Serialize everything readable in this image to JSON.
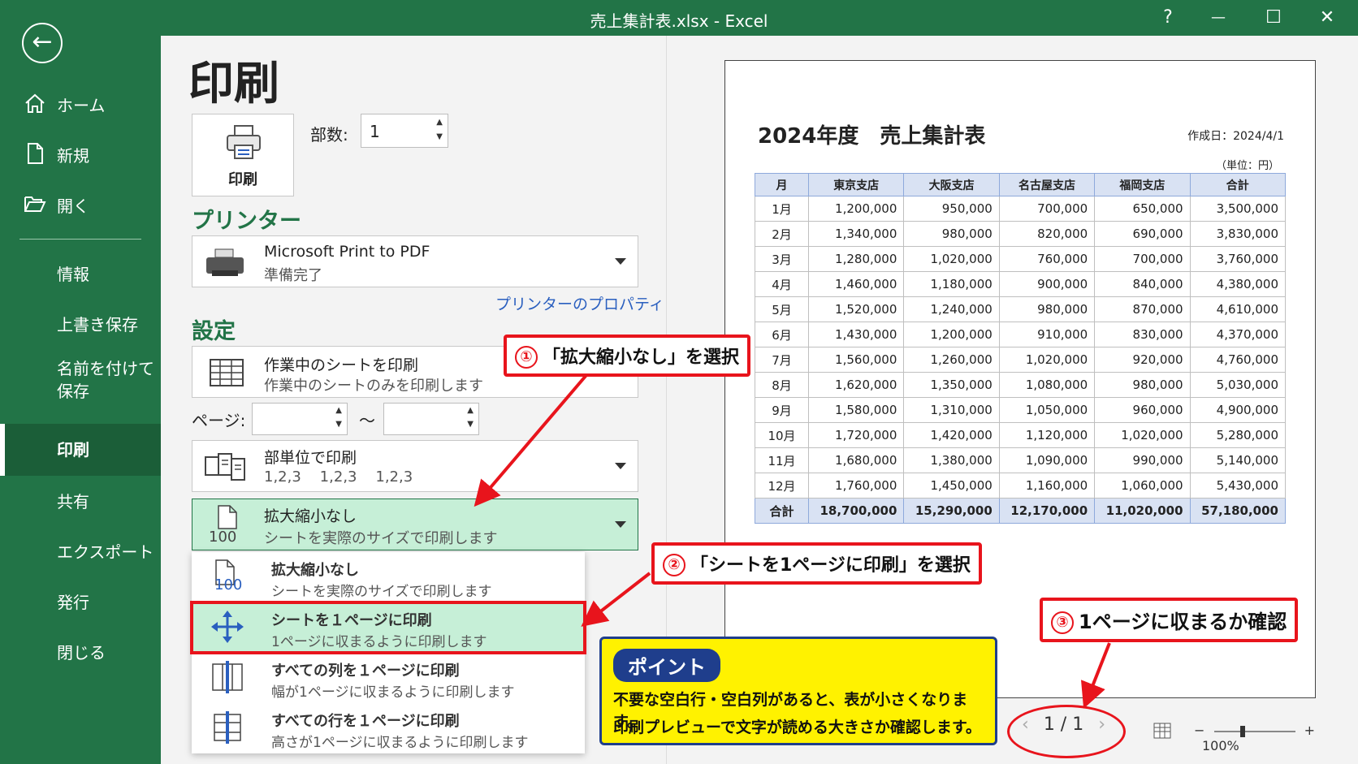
{
  "window": {
    "title": "売上集計表.xlsx  -  Excel",
    "help": "?",
    "minimize": "—",
    "maximize": "☐",
    "close": "✕"
  },
  "sidebar": {
    "back_icon": "arrow-left-icon",
    "top_items": [
      {
        "label": "ホーム",
        "icon": "home-icon"
      },
      {
        "label": "新規",
        "icon": "new-document-icon"
      },
      {
        "label": "開く",
        "icon": "folder-open-icon"
      }
    ],
    "items": [
      "情報",
      "上書き保存",
      "名前を付けて\n保存",
      "印刷",
      "共有",
      "エクスポート",
      "発行",
      "閉じる"
    ],
    "active": "印刷"
  },
  "print": {
    "heading": "印刷",
    "print_button": "印刷",
    "copies_label": "部数:",
    "copies_value": "1"
  },
  "printer": {
    "section": "プリンター",
    "name": "Microsoft Print to PDF",
    "status": "準備完了",
    "properties_link": "プリンターのプロパティ"
  },
  "settings": {
    "section": "設定",
    "what": {
      "title": "作業中のシートを印刷",
      "desc": "作業中のシートのみを印刷します"
    },
    "pages_label": "ページ:",
    "pages_to": "～",
    "collate": {
      "title": "部単位で印刷",
      "desc": "1,2,3    1,2,3    1,2,3"
    },
    "scaling": {
      "title": "拡大縮小なし",
      "desc": "シートを実際のサイズで印刷します",
      "icon_text": "100"
    }
  },
  "scaling_menu": [
    {
      "title": "拡大縮小なし",
      "desc": "シートを実際のサイズで印刷します",
      "icon": "no-scaling-icon",
      "icon_text": "100"
    },
    {
      "title": "シートを１ページに印刷",
      "desc": "1ページに収まるように印刷します",
      "icon": "fit-sheet-icon"
    },
    {
      "title": "すべての列を１ページに印刷",
      "desc": "幅が1ページに収まるように印刷します",
      "icon": "fit-columns-icon"
    },
    {
      "title": "すべての行を１ページに印刷",
      "desc": "高さが1ページに収まるように印刷します",
      "icon": "fit-rows-icon"
    }
  ],
  "callouts": {
    "c1": {
      "num": "①",
      "text": "「拡大縮小なし」を選択"
    },
    "c2": {
      "num": "②",
      "text": "「シートを1ページに印刷」を選択"
    },
    "c3": {
      "num": "③",
      "text": "1ページに収まるか確認"
    }
  },
  "point": {
    "tag": "ポイント",
    "line1": "不要な空白行・空白列があると、表が小さくなります。",
    "line2": "印刷プレビューで文字が読める大きさか確認します。"
  },
  "preview": {
    "title": "2024年度　売上集計表",
    "date": "作成日：2024/4/1",
    "unit": "（単位：円）",
    "headers": [
      "月",
      "東京支店",
      "大阪支店",
      "名古屋支店",
      "福岡支店",
      "合計"
    ],
    "rows": [
      [
        "1月",
        "1,200,000",
        "950,000",
        "700,000",
        "650,000",
        "3,500,000"
      ],
      [
        "2月",
        "1,340,000",
        "980,000",
        "820,000",
        "690,000",
        "3,830,000"
      ],
      [
        "3月",
        "1,280,000",
        "1,020,000",
        "760,000",
        "700,000",
        "3,760,000"
      ],
      [
        "4月",
        "1,460,000",
        "1,180,000",
        "900,000",
        "840,000",
        "4,380,000"
      ],
      [
        "5月",
        "1,520,000",
        "1,240,000",
        "980,000",
        "870,000",
        "4,610,000"
      ],
      [
        "6月",
        "1,430,000",
        "1,200,000",
        "910,000",
        "830,000",
        "4,370,000"
      ],
      [
        "7月",
        "1,560,000",
        "1,260,000",
        "1,020,000",
        "920,000",
        "4,760,000"
      ],
      [
        "8月",
        "1,620,000",
        "1,350,000",
        "1,080,000",
        "980,000",
        "5,030,000"
      ],
      [
        "9月",
        "1,580,000",
        "1,310,000",
        "1,050,000",
        "960,000",
        "4,900,000"
      ],
      [
        "10月",
        "1,720,000",
        "1,420,000",
        "1,120,000",
        "1,020,000",
        "5,280,000"
      ],
      [
        "11月",
        "1,680,000",
        "1,380,000",
        "1,090,000",
        "990,000",
        "5,140,000"
      ],
      [
        "12月",
        "1,760,000",
        "1,450,000",
        "1,160,000",
        "1,060,000",
        "5,430,000"
      ]
    ],
    "total": [
      "合計",
      "18,700,000",
      "15,290,000",
      "12,170,000",
      "11,020,000",
      "57,180,000"
    ]
  },
  "pager": {
    "prev": "‹",
    "text": "1 / 1",
    "next": "›"
  },
  "zoom": {
    "minus": "−",
    "plus": "+",
    "value": "100%"
  },
  "colors": {
    "excel_green": "#227447",
    "highlight": "#c6efd7",
    "callout_red": "#e8141c",
    "point_yellow": "#fff200",
    "point_navy": "#1f3e8c"
  }
}
